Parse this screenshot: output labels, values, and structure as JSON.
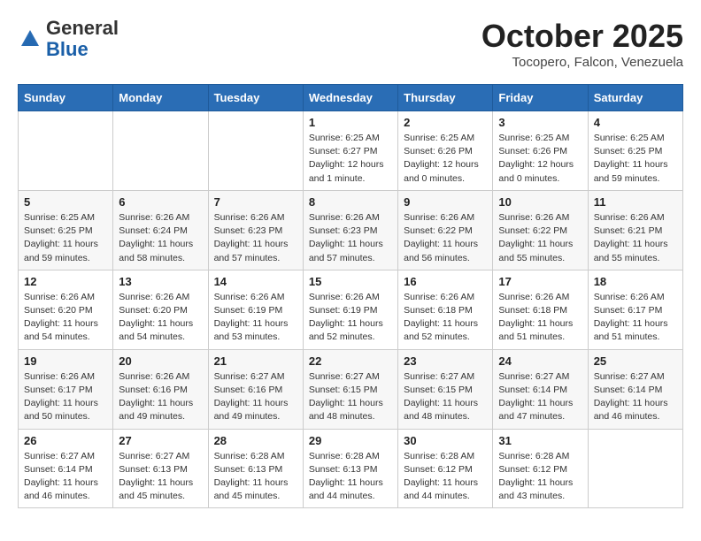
{
  "header": {
    "logo": {
      "general": "General",
      "blue": "Blue"
    },
    "title": "October 2025",
    "location": "Tocopero, Falcon, Venezuela"
  },
  "days_of_week": [
    "Sunday",
    "Monday",
    "Tuesday",
    "Wednesday",
    "Thursday",
    "Friday",
    "Saturday"
  ],
  "weeks": [
    [
      {
        "day": "",
        "info": ""
      },
      {
        "day": "",
        "info": ""
      },
      {
        "day": "",
        "info": ""
      },
      {
        "day": "1",
        "info": "Sunrise: 6:25 AM\nSunset: 6:27 PM\nDaylight: 12 hours\nand 1 minute."
      },
      {
        "day": "2",
        "info": "Sunrise: 6:25 AM\nSunset: 6:26 PM\nDaylight: 12 hours\nand 0 minutes."
      },
      {
        "day": "3",
        "info": "Sunrise: 6:25 AM\nSunset: 6:26 PM\nDaylight: 12 hours\nand 0 minutes."
      },
      {
        "day": "4",
        "info": "Sunrise: 6:25 AM\nSunset: 6:25 PM\nDaylight: 11 hours\nand 59 minutes."
      }
    ],
    [
      {
        "day": "5",
        "info": "Sunrise: 6:25 AM\nSunset: 6:25 PM\nDaylight: 11 hours\nand 59 minutes."
      },
      {
        "day": "6",
        "info": "Sunrise: 6:26 AM\nSunset: 6:24 PM\nDaylight: 11 hours\nand 58 minutes."
      },
      {
        "day": "7",
        "info": "Sunrise: 6:26 AM\nSunset: 6:23 PM\nDaylight: 11 hours\nand 57 minutes."
      },
      {
        "day": "8",
        "info": "Sunrise: 6:26 AM\nSunset: 6:23 PM\nDaylight: 11 hours\nand 57 minutes."
      },
      {
        "day": "9",
        "info": "Sunrise: 6:26 AM\nSunset: 6:22 PM\nDaylight: 11 hours\nand 56 minutes."
      },
      {
        "day": "10",
        "info": "Sunrise: 6:26 AM\nSunset: 6:22 PM\nDaylight: 11 hours\nand 55 minutes."
      },
      {
        "day": "11",
        "info": "Sunrise: 6:26 AM\nSunset: 6:21 PM\nDaylight: 11 hours\nand 55 minutes."
      }
    ],
    [
      {
        "day": "12",
        "info": "Sunrise: 6:26 AM\nSunset: 6:20 PM\nDaylight: 11 hours\nand 54 minutes."
      },
      {
        "day": "13",
        "info": "Sunrise: 6:26 AM\nSunset: 6:20 PM\nDaylight: 11 hours\nand 54 minutes."
      },
      {
        "day": "14",
        "info": "Sunrise: 6:26 AM\nSunset: 6:19 PM\nDaylight: 11 hours\nand 53 minutes."
      },
      {
        "day": "15",
        "info": "Sunrise: 6:26 AM\nSunset: 6:19 PM\nDaylight: 11 hours\nand 52 minutes."
      },
      {
        "day": "16",
        "info": "Sunrise: 6:26 AM\nSunset: 6:18 PM\nDaylight: 11 hours\nand 52 minutes."
      },
      {
        "day": "17",
        "info": "Sunrise: 6:26 AM\nSunset: 6:18 PM\nDaylight: 11 hours\nand 51 minutes."
      },
      {
        "day": "18",
        "info": "Sunrise: 6:26 AM\nSunset: 6:17 PM\nDaylight: 11 hours\nand 51 minutes."
      }
    ],
    [
      {
        "day": "19",
        "info": "Sunrise: 6:26 AM\nSunset: 6:17 PM\nDaylight: 11 hours\nand 50 minutes."
      },
      {
        "day": "20",
        "info": "Sunrise: 6:26 AM\nSunset: 6:16 PM\nDaylight: 11 hours\nand 49 minutes."
      },
      {
        "day": "21",
        "info": "Sunrise: 6:27 AM\nSunset: 6:16 PM\nDaylight: 11 hours\nand 49 minutes."
      },
      {
        "day": "22",
        "info": "Sunrise: 6:27 AM\nSunset: 6:15 PM\nDaylight: 11 hours\nand 48 minutes."
      },
      {
        "day": "23",
        "info": "Sunrise: 6:27 AM\nSunset: 6:15 PM\nDaylight: 11 hours\nand 48 minutes."
      },
      {
        "day": "24",
        "info": "Sunrise: 6:27 AM\nSunset: 6:14 PM\nDaylight: 11 hours\nand 47 minutes."
      },
      {
        "day": "25",
        "info": "Sunrise: 6:27 AM\nSunset: 6:14 PM\nDaylight: 11 hours\nand 46 minutes."
      }
    ],
    [
      {
        "day": "26",
        "info": "Sunrise: 6:27 AM\nSunset: 6:14 PM\nDaylight: 11 hours\nand 46 minutes."
      },
      {
        "day": "27",
        "info": "Sunrise: 6:27 AM\nSunset: 6:13 PM\nDaylight: 11 hours\nand 45 minutes."
      },
      {
        "day": "28",
        "info": "Sunrise: 6:28 AM\nSunset: 6:13 PM\nDaylight: 11 hours\nand 45 minutes."
      },
      {
        "day": "29",
        "info": "Sunrise: 6:28 AM\nSunset: 6:13 PM\nDaylight: 11 hours\nand 44 minutes."
      },
      {
        "day": "30",
        "info": "Sunrise: 6:28 AM\nSunset: 6:12 PM\nDaylight: 11 hours\nand 44 minutes."
      },
      {
        "day": "31",
        "info": "Sunrise: 6:28 AM\nSunset: 6:12 PM\nDaylight: 11 hours\nand 43 minutes."
      },
      {
        "day": "",
        "info": ""
      }
    ]
  ]
}
